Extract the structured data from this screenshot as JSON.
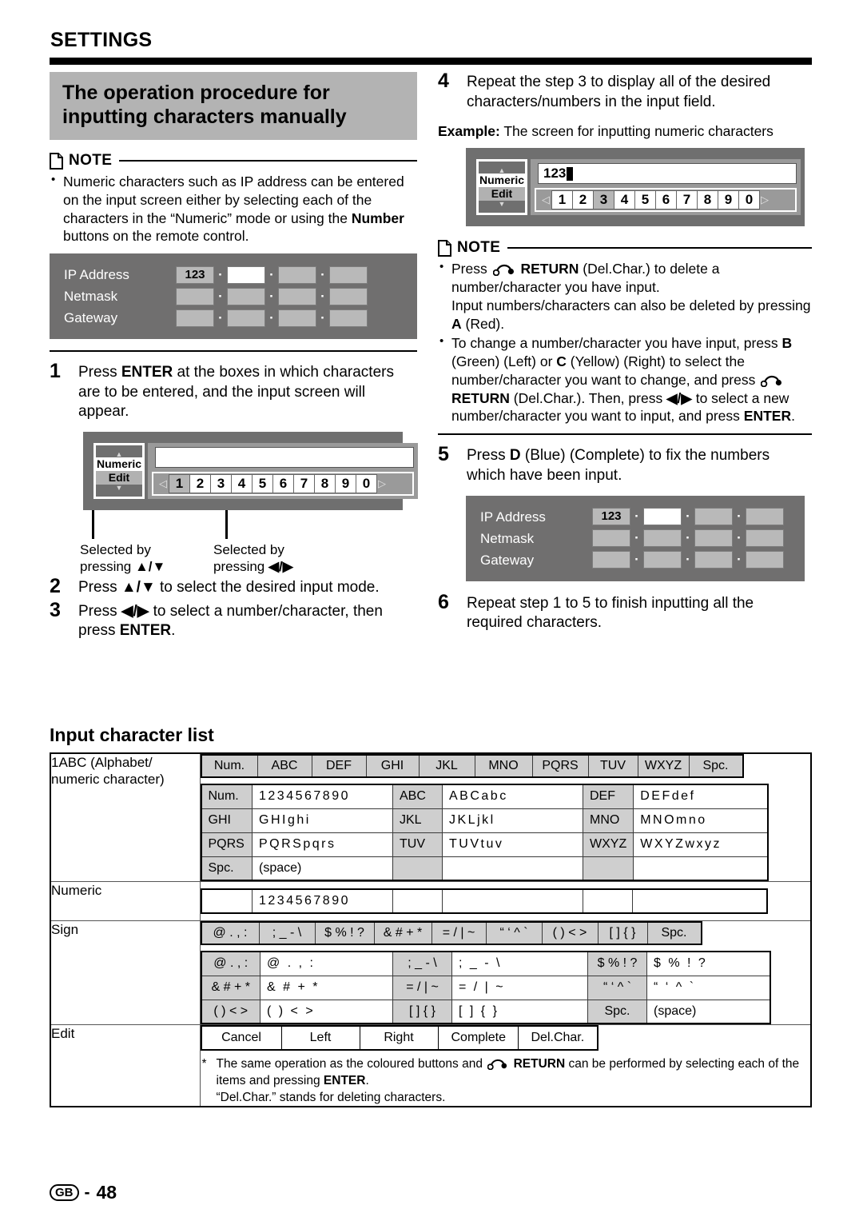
{
  "header": {
    "section_title": "SETTINGS",
    "banner_title": "The operation procedure for inputting characters manually"
  },
  "left_column": {
    "note": {
      "label": "NOTE",
      "items": [
        "Numeric characters such as IP address can be entered on the input screen either by selecting each of the characters in the “Numeric” mode or using the Number buttons on the remote control."
      ]
    },
    "osd_network": {
      "labels": [
        "IP Address",
        "Netmask",
        "Gateway"
      ],
      "first_cell_value": "123",
      "separator": "·"
    },
    "steps": [
      {
        "num": "1",
        "text": "Press ENTER at the boxes in which characters are to be entered, and the input screen will appear."
      },
      {
        "num": "2",
        "text": "Press ▲/▼ to select the desired input mode."
      },
      {
        "num": "3",
        "text": "Press ◀/▶ to select a number/character, then press ENTER."
      }
    ],
    "osd_input": {
      "mode_top": "Numeric",
      "mode_bottom": "Edit",
      "field_value": "",
      "keys": [
        "1",
        "2",
        "3",
        "4",
        "5",
        "6",
        "7",
        "8",
        "9",
        "0"
      ],
      "selected_key": "1",
      "left_arrow": "◁",
      "right_arrow": "▷",
      "up_arrow": "▲",
      "down_arrow": "▼"
    },
    "callouts": [
      "Selected by pressing ▲/▼",
      "Selected by pressing ◀/▶"
    ]
  },
  "right_column": {
    "step4": {
      "num": "4",
      "text": "Repeat the step 3 to display all of the desired characters/numbers in the input field."
    },
    "example_label": "Example:",
    "example_text": " The screen for inputting numeric characters",
    "osd_input": {
      "mode_top": "Numeric",
      "mode_bottom": "Edit",
      "field_value": "123",
      "keys": [
        "1",
        "2",
        "3",
        "4",
        "5",
        "6",
        "7",
        "8",
        "9",
        "0"
      ],
      "selected_key": "3",
      "left_arrow": "◁",
      "right_arrow": "▷"
    },
    "note": {
      "label": "NOTE",
      "item1_a": "Press ",
      "item1_b": "RETURN",
      "item1_c": " (Del.Char.) to delete a number/character you have input.",
      "item1_d": "Input numbers/characters can also be deleted by pressing ",
      "item1_e": "A",
      "item1_f": " (Red).",
      "item2_a": "To change a number/character you have input, press ",
      "item2_b": "B",
      "item2_c": " (Green) (Left) or ",
      "item2_d": "C",
      "item2_e": " (Yellow) (Right) to select the number/character you want to change, and press ",
      "item2_f": "RETURN",
      "item2_g": " (Del.Char.). Then, press ◀/▶ to select a new number/character you want to input, and press ",
      "item2_h": "ENTER",
      "item2_i": "."
    },
    "step5": {
      "num": "5",
      "text": "Press D (Blue) (Complete) to fix the numbers which have been input."
    },
    "osd_network": {
      "labels": [
        "IP Address",
        "Netmask",
        "Gateway"
      ],
      "first_cell_value": "123",
      "separator": "·"
    },
    "step6": {
      "num": "6",
      "text": "Repeat step 1 to 5 to finish inputting all the required characters."
    }
  },
  "input_character_list": {
    "title": "Input character list",
    "rows": [
      {
        "category": "1ABC (Alphabet/ numeric character)",
        "mode_strip": [
          "Num.",
          "ABC",
          "DEF",
          "GHI",
          "JKL",
          "MNO",
          "PQRS",
          "TUV",
          "WXYZ",
          "Spc."
        ],
        "detail": [
          [
            {
              "k": "Num.",
              "v": "1234567890"
            },
            {
              "k": "ABC",
              "v": "ABCabc"
            },
            {
              "k": "DEF",
              "v": "DEFdef"
            }
          ],
          [
            {
              "k": "GHI",
              "v": "GHIghi"
            },
            {
              "k": "JKL",
              "v": "JKLjkl"
            },
            {
              "k": "MNO",
              "v": "MNOmno"
            }
          ],
          [
            {
              "k": "PQRS",
              "v": "PQRSpqrs"
            },
            {
              "k": "TUV",
              "v": "TUVtuv"
            },
            {
              "k": "WXYZ",
              "v": "WXYZwxyz"
            }
          ],
          [
            {
              "k": "Spc.",
              "v": "(space)"
            },
            {
              "k": "",
              "v": ""
            },
            {
              "k": "",
              "v": ""
            }
          ]
        ]
      },
      {
        "category": "Numeric",
        "numeric_strip": [
          "",
          "1234567890",
          "",
          "",
          "",
          ""
        ]
      },
      {
        "category": "Sign",
        "mode_strip": [
          "@ . , :",
          "; _ - \\",
          "$ % ! ?",
          "& # + *",
          "= / | ~",
          "“ ‘ ^ `",
          "( ) < >",
          "[ ] { }",
          "Spc."
        ],
        "detail": [
          [
            {
              "k": "@ . , :",
              "v": "@ . , :"
            },
            {
              "k": "; _ - \\",
              "v": "; _ - \\"
            },
            {
              "k": "$ % ! ?",
              "v": "$ % ! ?"
            }
          ],
          [
            {
              "k": "& # + *",
              "v": "& # + *"
            },
            {
              "k": "= / | ~",
              "v": "= / | ~"
            },
            {
              "k": "“ ‘ ^ `",
              "v": "“ ‘ ^ `"
            }
          ],
          [
            {
              "k": "( ) < >",
              "v": "( ) < >"
            },
            {
              "k": "[ ] { }",
              "v": "[ ] { }"
            },
            {
              "k": "Spc.",
              "v": "(space)"
            }
          ]
        ]
      },
      {
        "category": "Edit",
        "edit_buttons": [
          "Cancel",
          "Left",
          "Right",
          "Complete",
          "Del.Char."
        ],
        "footnote_a": "The same operation as the coloured buttons and ",
        "footnote_b": "RETURN",
        "footnote_c": " can be performed by selecting each of the items and pressing ",
        "footnote_d": "ENTER",
        "footnote_e": ".",
        "footnote2": "“Del.Char.” stands for deleting characters."
      }
    ]
  },
  "footer": {
    "region": "GB",
    "dash": "-",
    "page_number": "48"
  }
}
